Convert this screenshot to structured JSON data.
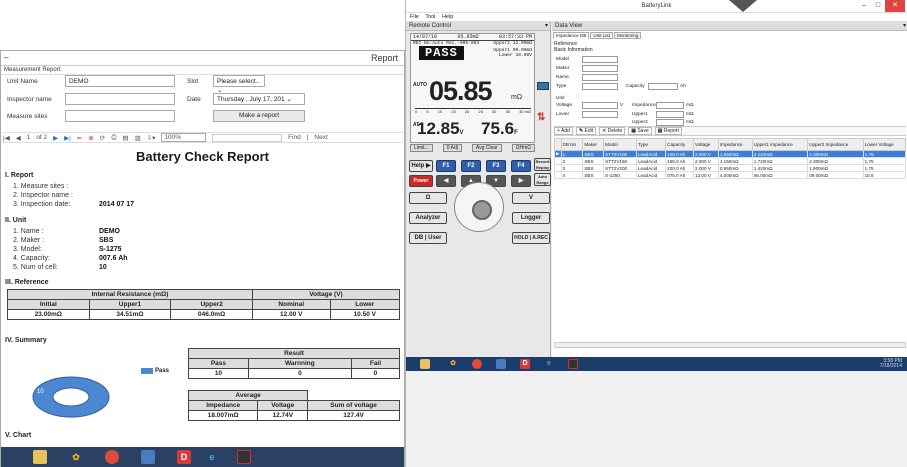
{
  "batterylink": {
    "title": "BatteryLink",
    "menu": [
      "File",
      "Tool",
      "Help"
    ],
    "remote_control": {
      "header": "Remote Control",
      "meter": {
        "date": "14/07/18",
        "reading_top": "05.85mΩ",
        "time": "03:57:33 PM",
        "rec": "REC No:Auto Rec.-005-003",
        "status": "PASS",
        "upper2": "Upper2 12.00mΩ",
        "upper1": "Upper1 09.00mΩ",
        "lower": "Lower 10.00V",
        "auto": "AUTO",
        "big_value": "05.85",
        "big_unit": "mΩ",
        "scale": [
          "0",
          "5",
          "10",
          "15",
          "20",
          "25",
          "30",
          "35",
          "40 mΩ"
        ],
        "at": "AT",
        "voltage": "12.85",
        "voltage_unit": "V",
        "temp": "75.6",
        "temp_unit": "F"
      },
      "mode_row": [
        "Limit...",
        "0 Adj",
        "Avg Clear",
        "ΩHmΩ"
      ],
      "buttons": {
        "help": "Help ▶",
        "f1": "F1",
        "f2": "F2",
        "f3": "F3",
        "f4": "F4",
        "record": "Record Replay",
        "power": "Power",
        "auto_range": "Auto Range",
        "ohm": "Ω",
        "volt": "V",
        "analyzer": "Analyzer",
        "logger": "Logger",
        "db_user": "DB | User",
        "hold": "HOLD | A.REC"
      }
    },
    "data_view": {
      "header": "Data View",
      "tabs": [
        "Impedance DB",
        "Unit List",
        "Monitoring"
      ],
      "reference": "Reference",
      "basic_info": "Basic Information",
      "fields": {
        "model": "Model",
        "maker": "Maker",
        "name": "Name",
        "type": "Type",
        "capacity": "Capacity",
        "capacity_unit": "Ah",
        "unit": "Unit",
        "voltage": "Voltage",
        "voltage_unit": "V",
        "lower": "Lower",
        "impedance": "Impedance",
        "upper1": "Upper1",
        "upper2": "Upper2",
        "mohm": "mΩ"
      },
      "toolbar": [
        "Add",
        "Edit",
        "Delete",
        "Save",
        "Report"
      ],
      "columns": [
        "DB No",
        "Maker",
        "Model",
        "Type",
        "Capacity",
        "Voltage",
        "Impedance",
        "Upper1 Impedance",
        "Upper2 Impedance",
        "Lower Voltage"
      ],
      "rows": [
        [
          "1",
          "SBS",
          "STT2V100",
          "LeadAcid",
          "100.0 Ah",
          "2.000 V",
          "1.550mΩ",
          "2.120mΩ",
          "2.300mΩ",
          "1.75"
        ],
        [
          "2",
          "SBS",
          "STT2V150",
          "LeadAcid",
          "165.0 Ah",
          "2.000 V",
          "1.150mΩ",
          "1.720mΩ",
          "2.300mΩ",
          "1.75"
        ],
        [
          "3",
          "SBS",
          "STT2V200",
          "LeadAcid",
          "220.0 Ah",
          "2.000 V",
          "0.950mΩ",
          "1.420mΩ",
          "1.900mΩ",
          "1.75"
        ],
        [
          "4",
          "SBS",
          "S-1250",
          "LeadAcid",
          "075.0 Ah",
          "12.00 V",
          "4.000mΩ",
          "06.00mΩ",
          "08.00mΩ",
          "10.5"
        ]
      ],
      "selected_row": 0
    },
    "taskbar": {
      "time": "3:58 PM",
      "date": "7/18/2014"
    }
  },
  "report_window": {
    "title": "Report",
    "section_label": "Measurement Report",
    "form": {
      "unit_name_label": "Unit Name",
      "unit_name_value": "DEMO",
      "slot_label": "Slot",
      "slot_value": "Please select..",
      "inspector_label": "Inspector name",
      "inspector_value": "",
      "date_label": "Date",
      "date_value": "Thursday ,   July    17, 201",
      "measure_label": "Measure sites",
      "measure_value": "",
      "make_button": "Make a report"
    },
    "viewer_toolbar": {
      "page": "1",
      "of": "of 2",
      "zoom": "100%",
      "find": "Find",
      "next": "Next"
    },
    "document": {
      "title": "Battery Check Report",
      "sec1": "I. Report",
      "report_items": [
        "1. Measure sites :",
        "2. Inspector name :",
        "3. Inspection date:"
      ],
      "inspection_date": "2014 07 17",
      "sec2": "II. Unit",
      "unit_labels": [
        "1. Name :",
        "2. Maker :",
        "3. Model:",
        "4. Capacity:",
        "5. Num of cell:"
      ],
      "unit_values": [
        "DEMO",
        "SBS",
        "S-1275",
        "007.6 Ah",
        "10"
      ],
      "sec3": "III. Reference",
      "ref_group1": "Internal Resistance (mΩ)",
      "ref_group2": "Voltage (V)",
      "ref_headers": [
        "Initial",
        "Upper1",
        "Upper2",
        "Nominal",
        "Lower"
      ],
      "ref_values": [
        "23.00mΩ",
        "34.51mΩ",
        "046.0mΩ",
        "12.00 V",
        "10.50 V"
      ],
      "sec4": "IV. Summary",
      "legend": "Pass",
      "donut_value": "10",
      "result_title": "Result",
      "result_headers": [
        "Pass",
        "Warnning",
        "Fail"
      ],
      "result_values": [
        "10",
        "0",
        "0"
      ],
      "average_title": "Average",
      "average_headers": [
        "Impedance",
        "Voltage",
        "Sum of voltage"
      ],
      "average_values": [
        "18.007mΩ",
        "12.74V",
        "127.4V"
      ],
      "sec5": "V. Chart"
    }
  },
  "colors": {
    "pass_blue": "#4b87d3",
    "taskbar": "#2a4163",
    "selected_row": "#3b7fd9"
  }
}
